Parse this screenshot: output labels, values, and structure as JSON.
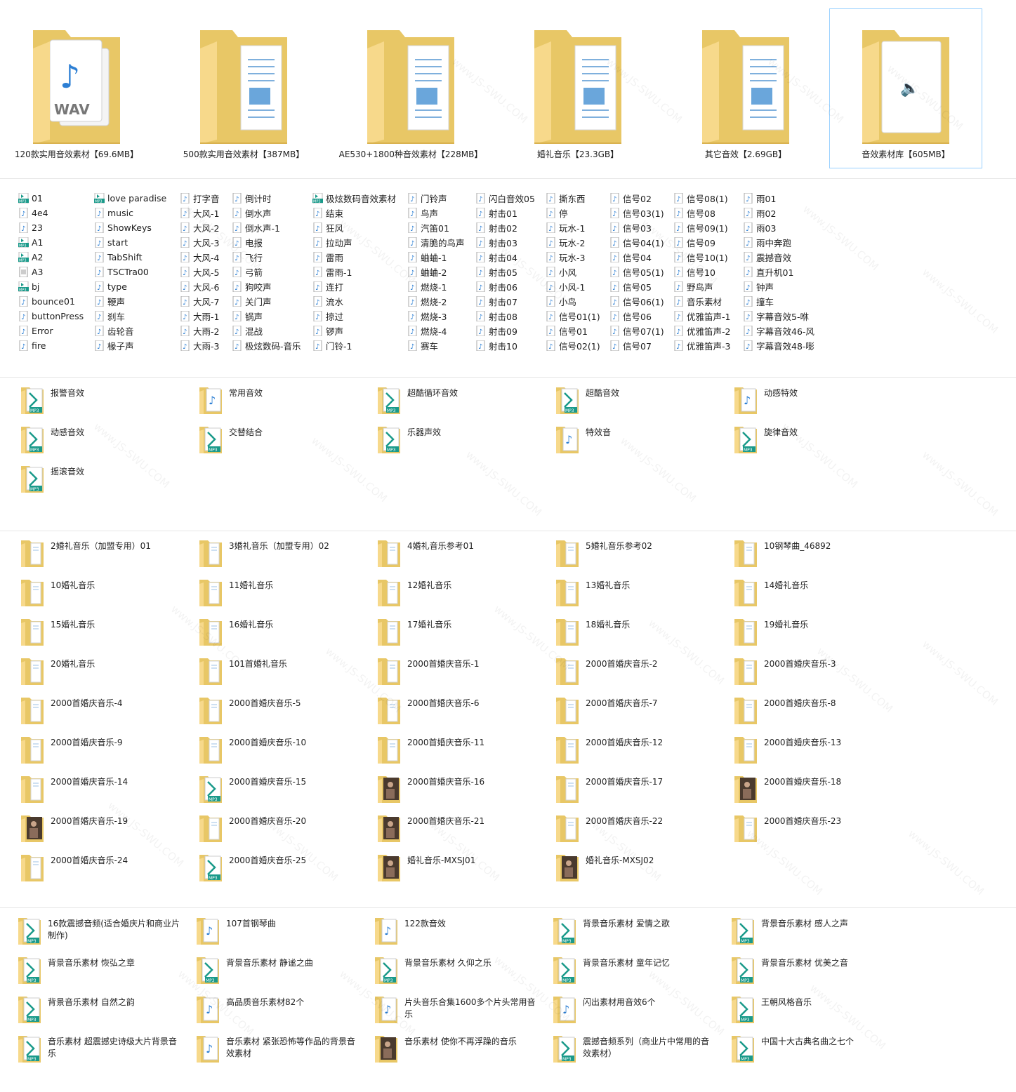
{
  "big_folders": [
    {
      "label": "120款实用音效素材【69.6MB】",
      "icon": "folder-wav-icon"
    },
    {
      "label": "500款实用音效素材【387MB】",
      "icon": "folder-doc-icon"
    },
    {
      "label": "AE530+1800种音效素材【228MB】",
      "icon": "folder-doc-icon"
    },
    {
      "label": "婚礼音乐【23.3GB】",
      "icon": "folder-doc-icon"
    },
    {
      "label": "其它音效【2.69GB】",
      "icon": "folder-doc-icon"
    },
    {
      "label": "音效素材库【605MB】",
      "icon": "folder-audio-icon"
    }
  ],
  "file_columns": [
    [
      {
        "name": "01",
        "icon": "mp3"
      },
      {
        "name": "4e4",
        "icon": "audio"
      },
      {
        "name": "23",
        "icon": "audio"
      },
      {
        "name": "A1",
        "icon": "mp3"
      },
      {
        "name": "A2",
        "icon": "mp3"
      },
      {
        "name": "A3",
        "icon": "generic"
      },
      {
        "name": "bj",
        "icon": "mp3"
      },
      {
        "name": "bounce01",
        "icon": "audio"
      },
      {
        "name": "buttonPress",
        "icon": "audio"
      },
      {
        "name": "Error",
        "icon": "audio"
      },
      {
        "name": "fire",
        "icon": "audio"
      }
    ],
    [
      {
        "name": "love paradise",
        "icon": "mp3"
      },
      {
        "name": "music",
        "icon": "audio"
      },
      {
        "name": "ShowKeys",
        "icon": "audio"
      },
      {
        "name": "start",
        "icon": "audio"
      },
      {
        "name": "TabShift",
        "icon": "audio"
      },
      {
        "name": "TSCTra00",
        "icon": "audio"
      },
      {
        "name": "type",
        "icon": "audio"
      },
      {
        "name": "鞭声",
        "icon": "audio"
      },
      {
        "name": "刹车",
        "icon": "audio"
      },
      {
        "name": "齿轮音",
        "icon": "audio"
      },
      {
        "name": "椽子声",
        "icon": "audio"
      }
    ],
    [
      {
        "name": "打字音",
        "icon": "audio"
      },
      {
        "name": "大风-1",
        "icon": "audio"
      },
      {
        "name": "大风-2",
        "icon": "audio"
      },
      {
        "name": "大风-3",
        "icon": "audio"
      },
      {
        "name": "大风-4",
        "icon": "audio"
      },
      {
        "name": "大风-5",
        "icon": "audio"
      },
      {
        "name": "大风-6",
        "icon": "audio"
      },
      {
        "name": "大风-7",
        "icon": "audio"
      },
      {
        "name": "大雨-1",
        "icon": "audio"
      },
      {
        "name": "大雨-2",
        "icon": "audio"
      },
      {
        "name": "大雨-3",
        "icon": "audio"
      }
    ],
    [
      {
        "name": "倒计时",
        "icon": "audio"
      },
      {
        "name": "倒水声",
        "icon": "audio"
      },
      {
        "name": "倒水声-1",
        "icon": "audio"
      },
      {
        "name": "电报",
        "icon": "audio"
      },
      {
        "name": "飞行",
        "icon": "audio"
      },
      {
        "name": "弓箭",
        "icon": "audio"
      },
      {
        "name": "狗咬声",
        "icon": "audio"
      },
      {
        "name": "关门声",
        "icon": "audio"
      },
      {
        "name": "锅声",
        "icon": "audio"
      },
      {
        "name": "混战",
        "icon": "audio"
      },
      {
        "name": "极炫数码-音乐",
        "icon": "audio"
      }
    ],
    [
      {
        "name": "极炫数码音效素材",
        "icon": "mp3"
      },
      {
        "name": "结束",
        "icon": "audio"
      },
      {
        "name": "狂风",
        "icon": "audio"
      },
      {
        "name": "拉动声",
        "icon": "audio"
      },
      {
        "name": "雷雨",
        "icon": "audio"
      },
      {
        "name": "雷雨-1",
        "icon": "audio"
      },
      {
        "name": "连打",
        "icon": "audio"
      },
      {
        "name": "流水",
        "icon": "audio"
      },
      {
        "name": "掠过",
        "icon": "audio"
      },
      {
        "name": "锣声",
        "icon": "audio"
      },
      {
        "name": "门铃-1",
        "icon": "audio"
      }
    ],
    [
      {
        "name": "门铃声",
        "icon": "audio"
      },
      {
        "name": "鸟声",
        "icon": "audio"
      },
      {
        "name": "汽笛01",
        "icon": "audio"
      },
      {
        "name": "清脆的鸟声",
        "icon": "audio"
      },
      {
        "name": "蛐蛐-1",
        "icon": "audio"
      },
      {
        "name": "蛐蛐-2",
        "icon": "audio"
      },
      {
        "name": "燃烧-1",
        "icon": "audio"
      },
      {
        "name": "燃烧-2",
        "icon": "audio"
      },
      {
        "name": "燃烧-3",
        "icon": "audio"
      },
      {
        "name": "燃烧-4",
        "icon": "audio"
      },
      {
        "name": "赛车",
        "icon": "audio"
      }
    ],
    [
      {
        "name": "闪白音效05",
        "icon": "audio"
      },
      {
        "name": "射击01",
        "icon": "audio"
      },
      {
        "name": "射击02",
        "icon": "audio"
      },
      {
        "name": "射击03",
        "icon": "audio"
      },
      {
        "name": "射击04",
        "icon": "audio"
      },
      {
        "name": "射击05",
        "icon": "audio"
      },
      {
        "name": "射击06",
        "icon": "audio"
      },
      {
        "name": "射击07",
        "icon": "audio"
      },
      {
        "name": "射击08",
        "icon": "audio"
      },
      {
        "name": "射击09",
        "icon": "audio"
      },
      {
        "name": "射击10",
        "icon": "audio"
      }
    ],
    [
      {
        "name": "撕东西",
        "icon": "audio"
      },
      {
        "name": "停",
        "icon": "audio"
      },
      {
        "name": "玩水-1",
        "icon": "audio"
      },
      {
        "name": "玩水-2",
        "icon": "audio"
      },
      {
        "name": "玩水-3",
        "icon": "audio"
      },
      {
        "name": "小风",
        "icon": "audio"
      },
      {
        "name": "小风-1",
        "icon": "audio"
      },
      {
        "name": "小鸟",
        "icon": "audio"
      },
      {
        "name": "信号01(1)",
        "icon": "audio"
      },
      {
        "name": "信号01",
        "icon": "audio"
      },
      {
        "name": "信号02(1)",
        "icon": "audio"
      }
    ],
    [
      {
        "name": "信号02",
        "icon": "audio"
      },
      {
        "name": "信号03(1)",
        "icon": "audio"
      },
      {
        "name": "信号03",
        "icon": "audio"
      },
      {
        "name": "信号04(1)",
        "icon": "audio"
      },
      {
        "name": "信号04",
        "icon": "audio"
      },
      {
        "name": "信号05(1)",
        "icon": "audio"
      },
      {
        "name": "信号05",
        "icon": "audio"
      },
      {
        "name": "信号06(1)",
        "icon": "audio"
      },
      {
        "name": "信号06",
        "icon": "audio"
      },
      {
        "name": "信号07(1)",
        "icon": "audio"
      },
      {
        "name": "信号07",
        "icon": "audio"
      }
    ],
    [
      {
        "name": "信号08(1)",
        "icon": "audio"
      },
      {
        "name": "信号08",
        "icon": "audio"
      },
      {
        "name": "信号09(1)",
        "icon": "audio"
      },
      {
        "name": "信号09",
        "icon": "audio"
      },
      {
        "name": "信号10(1)",
        "icon": "audio"
      },
      {
        "name": "信号10",
        "icon": "audio"
      },
      {
        "name": "野鸟声",
        "icon": "audio"
      },
      {
        "name": "音乐素材",
        "icon": "audio"
      },
      {
        "name": "优雅笛声-1",
        "icon": "audio"
      },
      {
        "name": "优雅笛声-2",
        "icon": "audio"
      },
      {
        "name": "优雅笛声-3",
        "icon": "audio"
      }
    ],
    [
      {
        "name": "雨01",
        "icon": "audio"
      },
      {
        "name": "雨02",
        "icon": "audio"
      },
      {
        "name": "雨03",
        "icon": "audio"
      },
      {
        "name": "雨中奔跑",
        "icon": "audio"
      },
      {
        "name": "震撼音效",
        "icon": "audio"
      },
      {
        "name": "直升机01",
        "icon": "audio"
      },
      {
        "name": "钟声",
        "icon": "audio"
      },
      {
        "name": "撞车",
        "icon": "audio"
      },
      {
        "name": "字幕音效5-咻",
        "icon": "audio"
      },
      {
        "name": "字幕音效46-风",
        "icon": "audio"
      },
      {
        "name": "字幕音效48-嘭",
        "icon": "audio"
      }
    ]
  ],
  "section3": [
    {
      "label": "报警音效",
      "icon": "folder-mp3"
    },
    {
      "label": "常用音效",
      "icon": "folder-audio"
    },
    {
      "label": "超酷循环音效",
      "icon": "folder-mp3"
    },
    {
      "label": "超酷音效",
      "icon": "folder-mp3"
    },
    {
      "label": "动感特效",
      "icon": "folder-audio"
    },
    {
      "label": "动感音效",
      "icon": "folder-mp3"
    },
    {
      "label": "交替结合",
      "icon": "folder-mp3"
    },
    {
      "label": "乐器声效",
      "icon": "folder-mp3"
    },
    {
      "label": "特效音",
      "icon": "folder-audio"
    },
    {
      "label": "旋律音效",
      "icon": "folder-mp3"
    },
    {
      "label": "摇滚音效",
      "icon": "folder-mp3"
    }
  ],
  "section4": [
    {
      "label": "2婚礼音乐（加盟专用）01",
      "icon": "folder-plain"
    },
    {
      "label": "3婚礼音乐（加盟专用）02",
      "icon": "folder-plain"
    },
    {
      "label": "4婚礼音乐参考01",
      "icon": "folder-plain"
    },
    {
      "label": "5婚礼音乐参考02",
      "icon": "folder-plain"
    },
    {
      "label": "10钢琴曲_46892",
      "icon": "folder-plain"
    },
    {
      "label": "10婚礼音乐",
      "icon": "folder-plain"
    },
    {
      "label": "11婚礼音乐",
      "icon": "folder-plain"
    },
    {
      "label": "12婚礼音乐",
      "icon": "folder-plain"
    },
    {
      "label": "13婚礼音乐",
      "icon": "folder-plain"
    },
    {
      "label": "14婚礼音乐",
      "icon": "folder-plain"
    },
    {
      "label": "15婚礼音乐",
      "icon": "folder-plain"
    },
    {
      "label": "16婚礼音乐",
      "icon": "folder-plain"
    },
    {
      "label": "17婚礼音乐",
      "icon": "folder-plain"
    },
    {
      "label": "18婚礼音乐",
      "icon": "folder-plain"
    },
    {
      "label": "19婚礼音乐",
      "icon": "folder-plain"
    },
    {
      "label": "20婚礼音乐",
      "icon": "folder-plain"
    },
    {
      "label": "101首婚礼音乐",
      "icon": "folder-plain"
    },
    {
      "label": "2000首婚庆音乐-1",
      "icon": "folder-plain"
    },
    {
      "label": "2000首婚庆音乐-2",
      "icon": "folder-plain"
    },
    {
      "label": "2000首婚庆音乐-3",
      "icon": "folder-plain"
    },
    {
      "label": "2000首婚庆音乐-4",
      "icon": "folder-plain"
    },
    {
      "label": "2000首婚庆音乐-5",
      "icon": "folder-plain"
    },
    {
      "label": "2000首婚庆音乐-6",
      "icon": "folder-plain"
    },
    {
      "label": "2000首婚庆音乐-7",
      "icon": "folder-plain"
    },
    {
      "label": "2000首婚庆音乐-8",
      "icon": "folder-plain"
    },
    {
      "label": "2000首婚庆音乐-9",
      "icon": "folder-plain"
    },
    {
      "label": "2000首婚庆音乐-10",
      "icon": "folder-plain"
    },
    {
      "label": "2000首婚庆音乐-11",
      "icon": "folder-plain"
    },
    {
      "label": "2000首婚庆音乐-12",
      "icon": "folder-plain"
    },
    {
      "label": "2000首婚庆音乐-13",
      "icon": "folder-plain"
    },
    {
      "label": "2000首婚庆音乐-14",
      "icon": "folder-plain"
    },
    {
      "label": "2000首婚庆音乐-15",
      "icon": "folder-mp3"
    },
    {
      "label": "2000首婚庆音乐-16",
      "icon": "folder-photo"
    },
    {
      "label": "2000首婚庆音乐-17",
      "icon": "folder-plain"
    },
    {
      "label": "2000首婚庆音乐-18",
      "icon": "folder-photo"
    },
    {
      "label": "2000首婚庆音乐-19",
      "icon": "folder-photo"
    },
    {
      "label": "2000首婚庆音乐-20",
      "icon": "folder-plain"
    },
    {
      "label": "2000首婚庆音乐-21",
      "icon": "folder-photo"
    },
    {
      "label": "2000首婚庆音乐-22",
      "icon": "folder-plain"
    },
    {
      "label": "2000首婚庆音乐-23",
      "icon": "folder-plain"
    },
    {
      "label": "2000首婚庆音乐-24",
      "icon": "folder-plain"
    },
    {
      "label": "2000首婚庆音乐-25",
      "icon": "folder-mp3"
    },
    {
      "label": "婚礼音乐-MXSJ01",
      "icon": "folder-photo"
    },
    {
      "label": "婚礼音乐-MXSJ02",
      "icon": "folder-photo"
    }
  ],
  "section5": [
    {
      "label": "16款震撼音频(适合婚庆片和商业片制作)",
      "icon": "folder-mp3"
    },
    {
      "label": "107首钢琴曲",
      "icon": "folder-audio"
    },
    {
      "label": "122款音效",
      "icon": "folder-audio"
    },
    {
      "label": "背景音乐素材 爱情之歌",
      "icon": "folder-mp3"
    },
    {
      "label": "背景音乐素材 感人之声",
      "icon": "folder-mp3"
    },
    {
      "label": "背景音乐素材 恢弘之章",
      "icon": "folder-mp3"
    },
    {
      "label": "背景音乐素材 静谧之曲",
      "icon": "folder-mp3"
    },
    {
      "label": "背景音乐素材 久仰之乐",
      "icon": "folder-mp3"
    },
    {
      "label": "背景音乐素材 童年记忆",
      "icon": "folder-mp3"
    },
    {
      "label": "背景音乐素材 优美之音",
      "icon": "folder-mp3"
    },
    {
      "label": "背景音乐素材 自然之韵",
      "icon": "folder-mp3"
    },
    {
      "label": "高品质音乐素材82个",
      "icon": "folder-audio"
    },
    {
      "label": "片头音乐合集1600多个片头常用音乐",
      "icon": "folder-audio"
    },
    {
      "label": "闪出素材用音效6个",
      "icon": "folder-audio"
    },
    {
      "label": "王朝风格音乐",
      "icon": "folder-mp3"
    },
    {
      "label": "音乐素材 超震撼史诗级大片背景音乐",
      "icon": "folder-mp3"
    },
    {
      "label": "音乐素材 紧张恐怖等作品的背景音效素材",
      "icon": "folder-audio"
    },
    {
      "label": "音乐素材 使你不再浮躁的音乐",
      "icon": "folder-photo"
    },
    {
      "label": "震撼音频系列（商业片中常用的音效素材）",
      "icon": "folder-mp3"
    },
    {
      "label": "中国十大古典名曲之七个",
      "icon": "folder-mp3"
    }
  ],
  "watermark_text": "www.JS-SWU.COM",
  "colors": {
    "folder_back": "#e8c766",
    "folder_front": "#f7d98b",
    "mp3_badge": "#1a9a8a",
    "note_blue": "#2d7fd4",
    "selection_border": "#99d1ff"
  }
}
